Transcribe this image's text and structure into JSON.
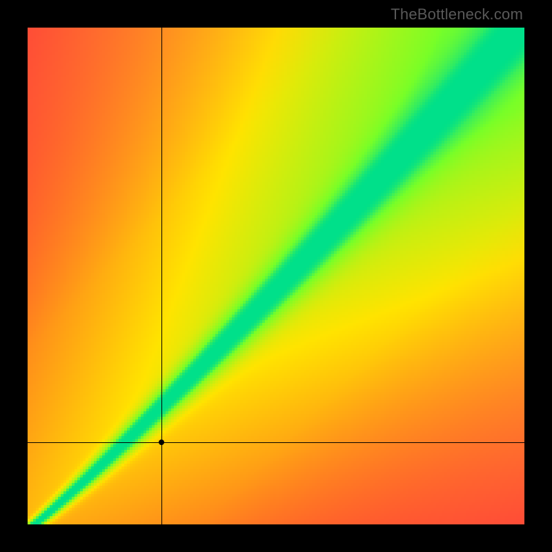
{
  "watermark": "TheBottleneck.com",
  "chart_data": {
    "type": "heatmap",
    "title": "",
    "xlabel": "",
    "ylabel": "",
    "xlim": [
      0,
      1
    ],
    "ylim": [
      0,
      1
    ],
    "colorscale": {
      "low_left_bottom": "#ff2a3a",
      "mid": "#ffe400",
      "ridge": "#00e08a",
      "high_right_top": "#6fff6f"
    },
    "ridge_description": "green diagonal band from bottom-left to top-right with slight downward curve near origin; background gradient from red (off-diagonal) through yellow to green (upper-right)",
    "crosshair": {
      "x": 0.27,
      "y": 0.165
    },
    "point": {
      "x": 0.27,
      "y": 0.165
    },
    "pixelated": true,
    "resolution_hint": 180
  }
}
